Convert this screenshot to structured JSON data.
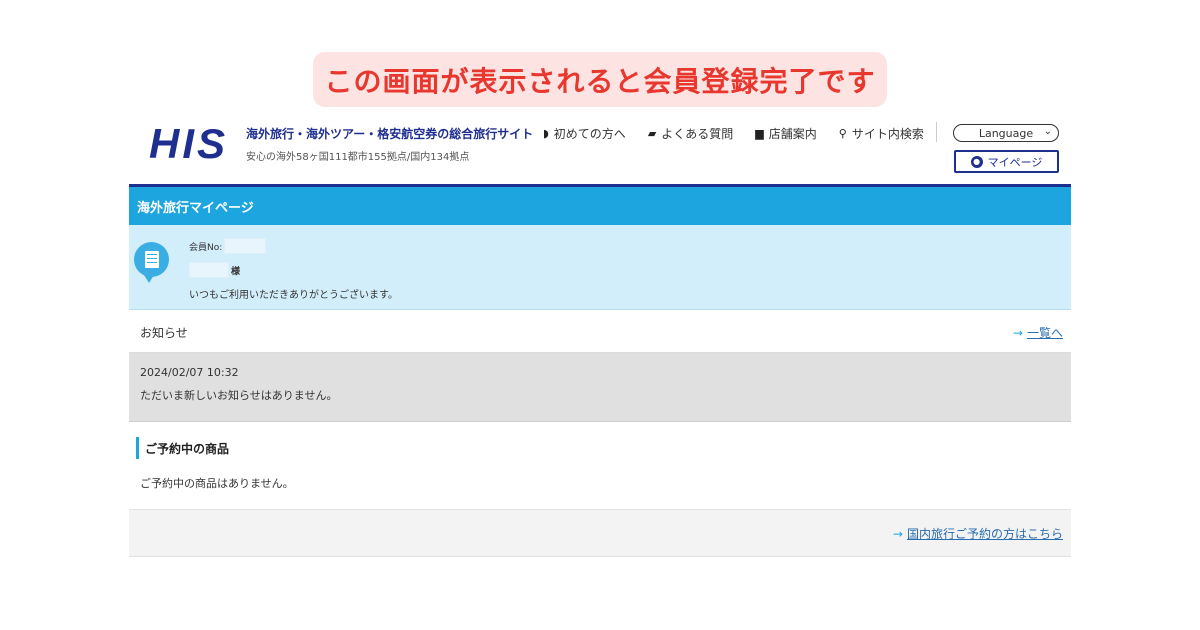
{
  "banner": {
    "text": "この画面が表示されると会員登録完了です"
  },
  "header": {
    "logo": "HIS",
    "tagline": "海外旅行・海外ツアー・格安航空券の総合旅行サイト",
    "subtagline": "安心の海外58ヶ国111都市155拠点/国内134拠点",
    "nav": [
      {
        "icon": "beginner-mark-icon",
        "label": "初めての方へ"
      },
      {
        "icon": "chat-bubble-icon",
        "label": "よくある質問"
      },
      {
        "icon": "store-icon",
        "label": "店舗案内"
      },
      {
        "icon": "search-icon",
        "label": "サイト内検索"
      }
    ],
    "language": "Language",
    "mypage": "マイページ"
  },
  "mypage": {
    "title": "海外旅行マイページ",
    "member_no_label": "会員No:",
    "honorific": "様",
    "greeting": "いつもご利用いただきありがとうございます。"
  },
  "news": {
    "label": "お知らせ",
    "more": "一覧へ",
    "date": "2024/02/07 10:32",
    "message": "ただいま新しいお知らせはありません。"
  },
  "reservation": {
    "heading": "ご予約中の商品",
    "message": "ご予約中の商品はありません。",
    "domestic_link": "国内旅行ご予約の方はこちら"
  },
  "colors": {
    "brand_navy": "#1f2f8f",
    "accent_blue": "#1da5e0",
    "banner_red": "#e8372e",
    "banner_bg": "#fde4e2"
  }
}
